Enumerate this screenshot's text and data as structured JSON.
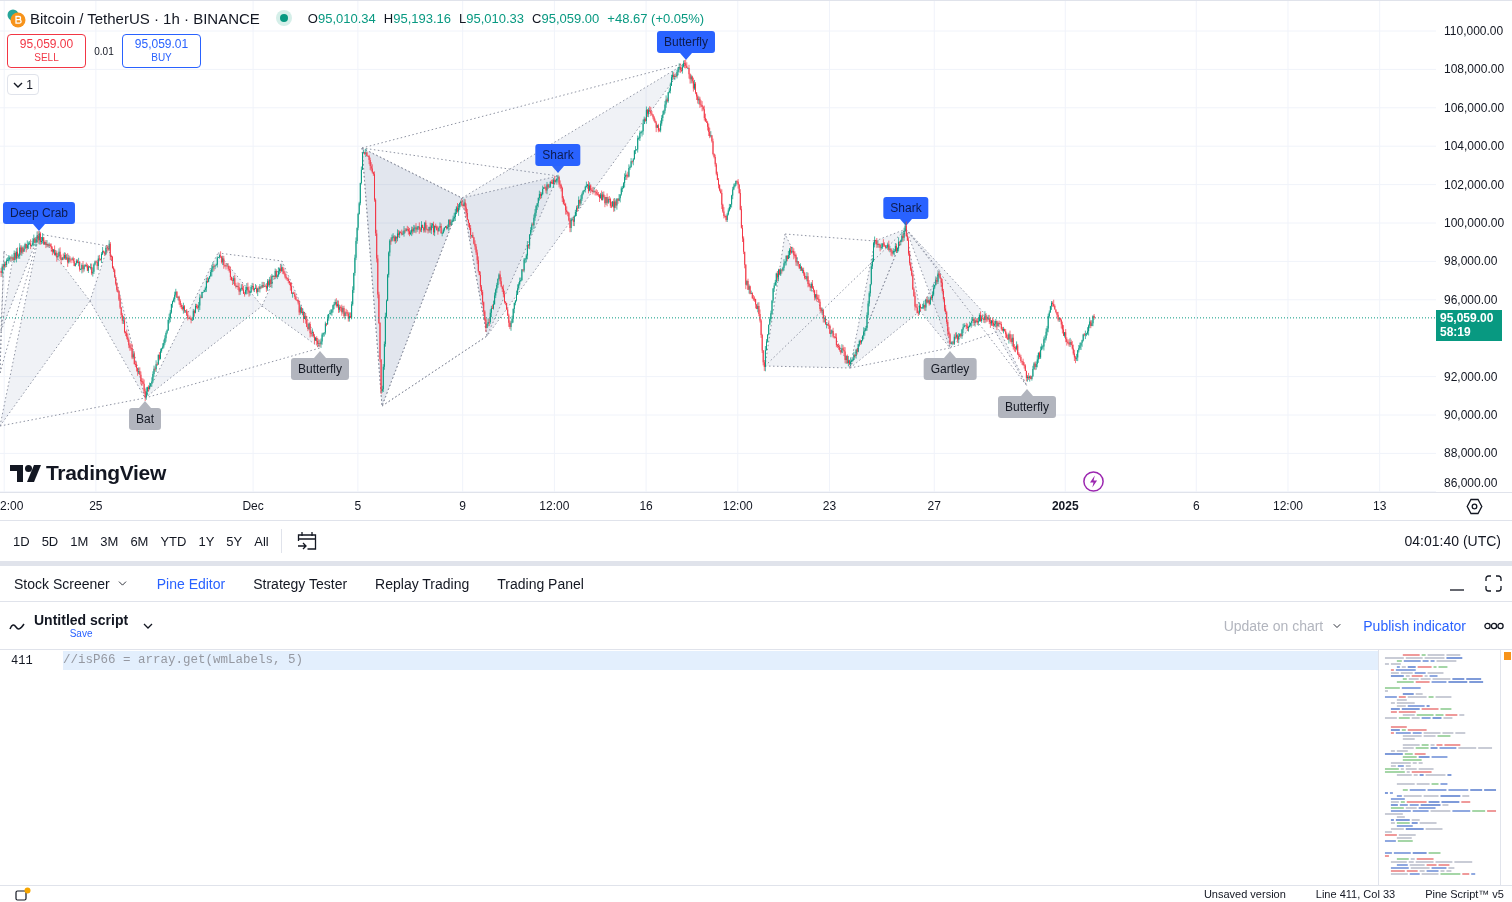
{
  "symbol_header": {
    "title": "Bitcoin / TetherUS · 1h · BINANCE",
    "ohlc": [
      {
        "label": "O",
        "value": "95,010.34"
      },
      {
        "label": "H",
        "value": "95,193.16"
      },
      {
        "label": "L",
        "value": "95,010.33"
      },
      {
        "label": "C",
        "value": "95,059.00"
      }
    ],
    "change": "+48.67 (+0.05%)"
  },
  "order_buttons": [
    {
      "kind": "sell",
      "price": "95,059.00",
      "label": "SELL"
    },
    {
      "kind": "buy",
      "price": "95,059.01",
      "label": "BUY"
    }
  ],
  "spread": "0.01",
  "indicators_toggle": {
    "label": "1"
  },
  "chart": {
    "patterns": [
      {
        "name": "Deep Crab",
        "kind": "high"
      },
      {
        "name": "Bat",
        "kind": "low"
      },
      {
        "name": "Butterfly",
        "kind": "low"
      },
      {
        "name": "Shark",
        "kind": "high"
      },
      {
        "name": "Butterfly",
        "kind": "high"
      },
      {
        "name": "Shark",
        "kind": "high"
      },
      {
        "name": "Gartley",
        "kind": "low"
      },
      {
        "name": "Butterfly",
        "kind": "low"
      }
    ],
    "last_price": {
      "price": "95,059.00",
      "countdown": "58:19"
    },
    "logo": "TradingView"
  },
  "price_axis": [
    "110,000.00",
    "108,000.00",
    "106,000.00",
    "104,000.00",
    "102,000.00",
    "100,000.00",
    "98,000.00",
    "96,000.00",
    "92,000.00",
    "90,000.00",
    "88,000.00",
    "86,000.00"
  ],
  "time_axis": [
    {
      "label": "2:00",
      "kind": "time"
    },
    {
      "label": "25",
      "kind": "day"
    },
    {
      "label": "Dec",
      "kind": "month"
    },
    {
      "label": "5",
      "kind": "day"
    },
    {
      "label": "9",
      "kind": "day"
    },
    {
      "label": "12:00",
      "kind": "time"
    },
    {
      "label": "16",
      "kind": "day"
    },
    {
      "label": "12:00",
      "kind": "time"
    },
    {
      "label": "23",
      "kind": "day"
    },
    {
      "label": "27",
      "kind": "day"
    },
    {
      "label": "2025",
      "kind": "year"
    },
    {
      "label": "6",
      "kind": "day"
    },
    {
      "label": "12:00",
      "kind": "time"
    },
    {
      "label": "13",
      "kind": "day"
    }
  ],
  "time_ranges": [
    "1D",
    "5D",
    "1M",
    "3M",
    "6M",
    "YTD",
    "1Y",
    "5Y",
    "All"
  ],
  "clock": "04:01:40 (UTC)",
  "panel_tabs": [
    {
      "label": "Stock Screener",
      "selected": false,
      "has_menu": true
    },
    {
      "label": "Pine Editor",
      "selected": true,
      "has_menu": false
    },
    {
      "label": "Strategy Tester",
      "selected": false,
      "has_menu": false
    },
    {
      "label": "Replay Trading",
      "selected": false,
      "has_menu": false
    },
    {
      "label": "Trading Panel",
      "selected": false,
      "has_menu": false
    }
  ],
  "script_bar": {
    "title": "Untitled script",
    "save_link": "Save",
    "update_button": {
      "label": "Update on chart",
      "disabled": true
    },
    "publish_button": "Publish indicator"
  },
  "editor": {
    "lines": [
      {
        "number": "411",
        "code": "//isP66 = array.get(wmLabels, 5)",
        "selected": true
      }
    ]
  },
  "status_bar": [
    "Unsaved version",
    "Line 411, Col 33",
    "Pine Script™ v5"
  ]
}
